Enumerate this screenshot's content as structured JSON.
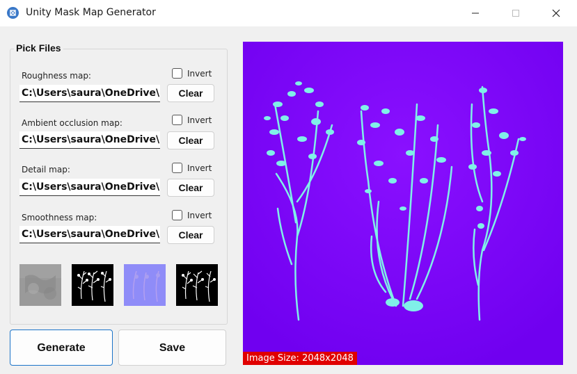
{
  "window": {
    "title": "Unity Mask Map Generator"
  },
  "pick_files": {
    "title": "Pick Files",
    "rows": [
      {
        "label": "Roughness map:",
        "path": "C:\\Users\\saura\\OneDrive\\De",
        "invert_label": "Invert",
        "invert_checked": false,
        "clear_label": "Clear"
      },
      {
        "label": "Ambient occlusion map:",
        "path": "C:\\Users\\saura\\OneDrive\\De",
        "invert_label": "Invert",
        "invert_checked": false,
        "clear_label": "Clear"
      },
      {
        "label": "Detail map:",
        "path": "C:\\Users\\saura\\OneDrive\\De",
        "invert_label": "Invert",
        "invert_checked": false,
        "clear_label": "Clear"
      },
      {
        "label": "Smoothness map:",
        "path": "C:\\Users\\saura\\OneDrive\\De",
        "invert_label": "Invert",
        "invert_checked": false,
        "clear_label": "Clear"
      }
    ]
  },
  "actions": {
    "generate_label": "Generate",
    "save_label": "Save"
  },
  "preview": {
    "size_label": "Image Size: 2048x2048"
  },
  "colors": {
    "preview_bg": "#7a00ff",
    "plant": "#80f0e8",
    "accent": "#1a73c8",
    "size_badge": "#e00000"
  }
}
